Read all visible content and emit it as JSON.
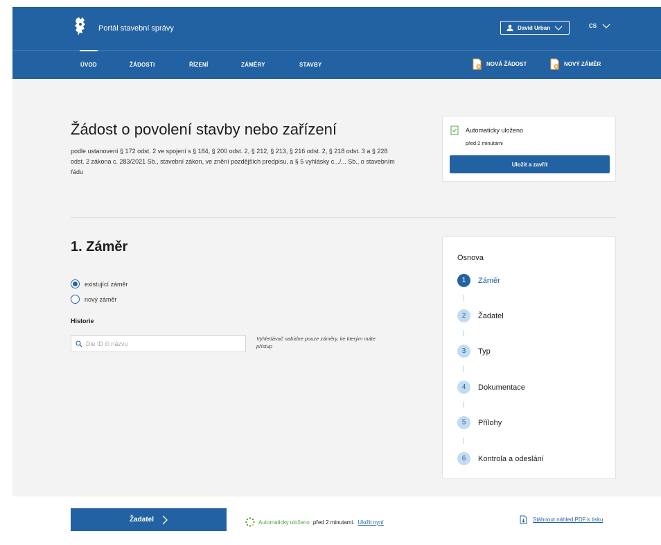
{
  "header": {
    "portal_title": "Portál stavební správy",
    "user_name": "David Urban",
    "language": "CS"
  },
  "nav": {
    "items": [
      "ÚVOD",
      "ŽÁDOSTI",
      "ŘÍZENÍ",
      "ZÁMĚRY",
      "STAVBY"
    ],
    "active": "ÚVOD",
    "new_request": "NOVÁ ŽÁDOST",
    "new_project": "NOVÝ ZÁMĚR"
  },
  "intro": {
    "title": "Žádost o povolení stavby nebo zařízení",
    "legal_text": "podle ustanovení § 172 odst. 2 ve spojení s § 184, § 200 odst. 2, § 212, § 213, § 216 odst. 2, § 218 odst. 3 a § 228 odst. 2 zákona c. 283/2021 Sb., stavební zákon, ve znění pozdějších predpisu, a § 5 vyhlásky c.../... Sb., o stavebním řádu"
  },
  "save_card": {
    "title": "Automaticky uloženo",
    "time": "před 2 minutami",
    "button": "Uložit a zavřít"
  },
  "section": {
    "title": "1. Záměr",
    "radio_existing": "existující záměr",
    "radio_new": "nový záměr",
    "selected": "existující záměr",
    "history_label": "Historie",
    "search_placeholder": "Dle ID či názvu",
    "search_hint": "Vyhledávač nabídne pouze záměry, ke kterým máte přístup"
  },
  "outline": {
    "title": "Osnova",
    "steps": [
      {
        "num": "1",
        "label": "Záměr"
      },
      {
        "num": "2",
        "label": "Žadatel"
      },
      {
        "num": "3",
        "label": "Typ"
      },
      {
        "num": "4",
        "label": "Dokumentace"
      },
      {
        "num": "5",
        "label": "Přílohy"
      },
      {
        "num": "6",
        "label": "Kontrola a odeslání"
      }
    ],
    "active_step": "1"
  },
  "footer": {
    "next_button": "Žadatel",
    "autosave_green": "Automaticky uloženo",
    "autosave_rest": "před 2 minutami.",
    "save_now": "Uložit nyní",
    "pdf_link": "Stáhnout náhled PDF k tisku"
  },
  "colors": {
    "primary": "#2362a2",
    "background": "#f3f3f3",
    "success": "#4fa33a",
    "step_badge": "#c3dcf1"
  }
}
